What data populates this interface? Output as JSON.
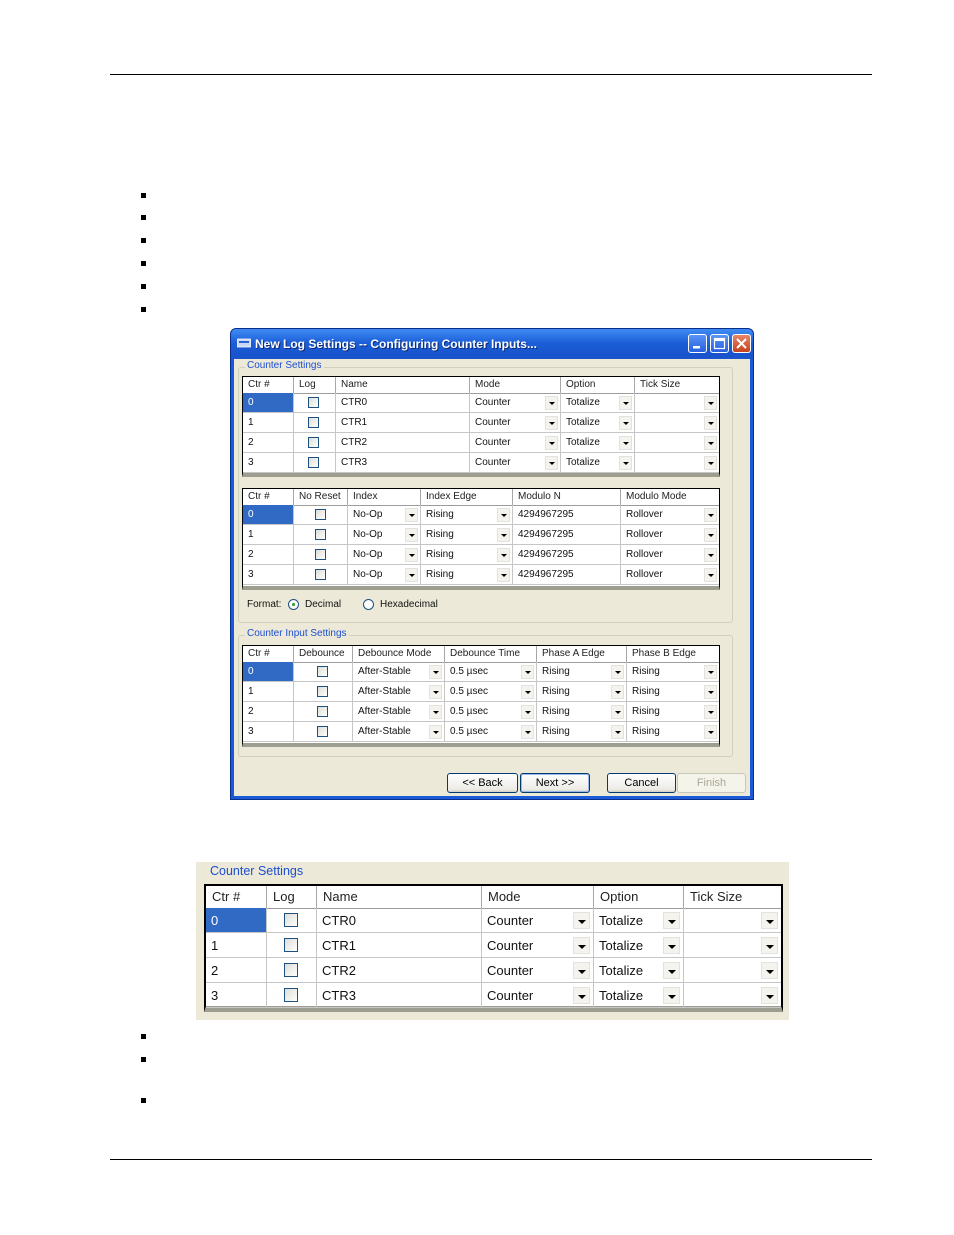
{
  "window": {
    "title": "New Log Settings -- Configuring Counter Inputs...",
    "colors": {
      "titlebar": "#1c5fd8",
      "client": "#ece9d8",
      "selection": "#316ac5",
      "group_label": "#1c4fd1"
    }
  },
  "counter_settings": {
    "label": "Counter Settings",
    "columns": [
      "Ctr #",
      "Log",
      "Name",
      "Mode",
      "Option",
      "Tick Size"
    ],
    "rows": [
      {
        "ctr": "0",
        "name": "CTR0",
        "mode": "Counter",
        "option": "Totalize",
        "tick": ""
      },
      {
        "ctr": "1",
        "name": "CTR1",
        "mode": "Counter",
        "option": "Totalize",
        "tick": ""
      },
      {
        "ctr": "2",
        "name": "CTR2",
        "mode": "Counter",
        "option": "Totalize",
        "tick": ""
      },
      {
        "ctr": "3",
        "name": "CTR3",
        "mode": "Counter",
        "option": "Totalize",
        "tick": ""
      }
    ]
  },
  "counter_options": {
    "columns": [
      "Ctr #",
      "No Reset",
      "Index",
      "Index Edge",
      "Modulo N",
      "Modulo Mode"
    ],
    "rows": [
      {
        "ctr": "0",
        "index": "No-Op",
        "index_edge": "Rising",
        "modulo_n": "4294967295",
        "modulo_mode": "Rollover"
      },
      {
        "ctr": "1",
        "index": "No-Op",
        "index_edge": "Rising",
        "modulo_n": "4294967295",
        "modulo_mode": "Rollover"
      },
      {
        "ctr": "2",
        "index": "No-Op",
        "index_edge": "Rising",
        "modulo_n": "4294967295",
        "modulo_mode": "Rollover"
      },
      {
        "ctr": "3",
        "index": "No-Op",
        "index_edge": "Rising",
        "modulo_n": "4294967295",
        "modulo_mode": "Rollover"
      }
    ]
  },
  "format": {
    "label": "Format:",
    "decimal": "Decimal",
    "hex": "Hexadecimal",
    "selected": "decimal"
  },
  "counter_input_settings": {
    "label": "Counter Input Settings",
    "columns": [
      "Ctr #",
      "Debounce",
      "Debounce Mode",
      "Debounce Time",
      "Phase A Edge",
      "Phase B Edge"
    ],
    "rows": [
      {
        "ctr": "0",
        "mode": "After-Stable",
        "time": "0.5 µsec",
        "a": "Rising",
        "b": "Rising"
      },
      {
        "ctr": "1",
        "mode": "After-Stable",
        "time": "0.5 µsec",
        "a": "Rising",
        "b": "Rising"
      },
      {
        "ctr": "2",
        "mode": "After-Stable",
        "time": "0.5 µsec",
        "a": "Rising",
        "b": "Rising"
      },
      {
        "ctr": "3",
        "mode": "After-Stable",
        "time": "0.5 µsec",
        "a": "Rising",
        "b": "Rising"
      }
    ]
  },
  "buttons": {
    "back": "<< Back",
    "next": "Next >>",
    "cancel": "Cancel",
    "finish": "Finish"
  }
}
